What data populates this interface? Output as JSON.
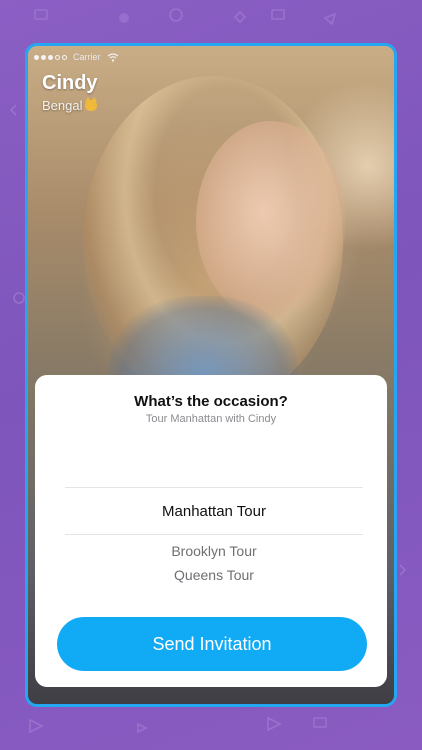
{
  "colors": {
    "background": "#8b5fc4",
    "frame": "#25a6f2",
    "accent": "#11aaf5"
  },
  "status": {
    "carrier": "Carrier"
  },
  "profile": {
    "name": "Cindy",
    "breed": "Bengal",
    "breed_icon": "cat-face-icon"
  },
  "sheet": {
    "title": "What’s the occasion?",
    "subtitle": "Tour Manhattan with Cindy",
    "selected_option": "Manhattan Tour",
    "options": [
      "Brooklyn Tour",
      "Queens Tour"
    ],
    "send_label": "Send Invitation"
  }
}
